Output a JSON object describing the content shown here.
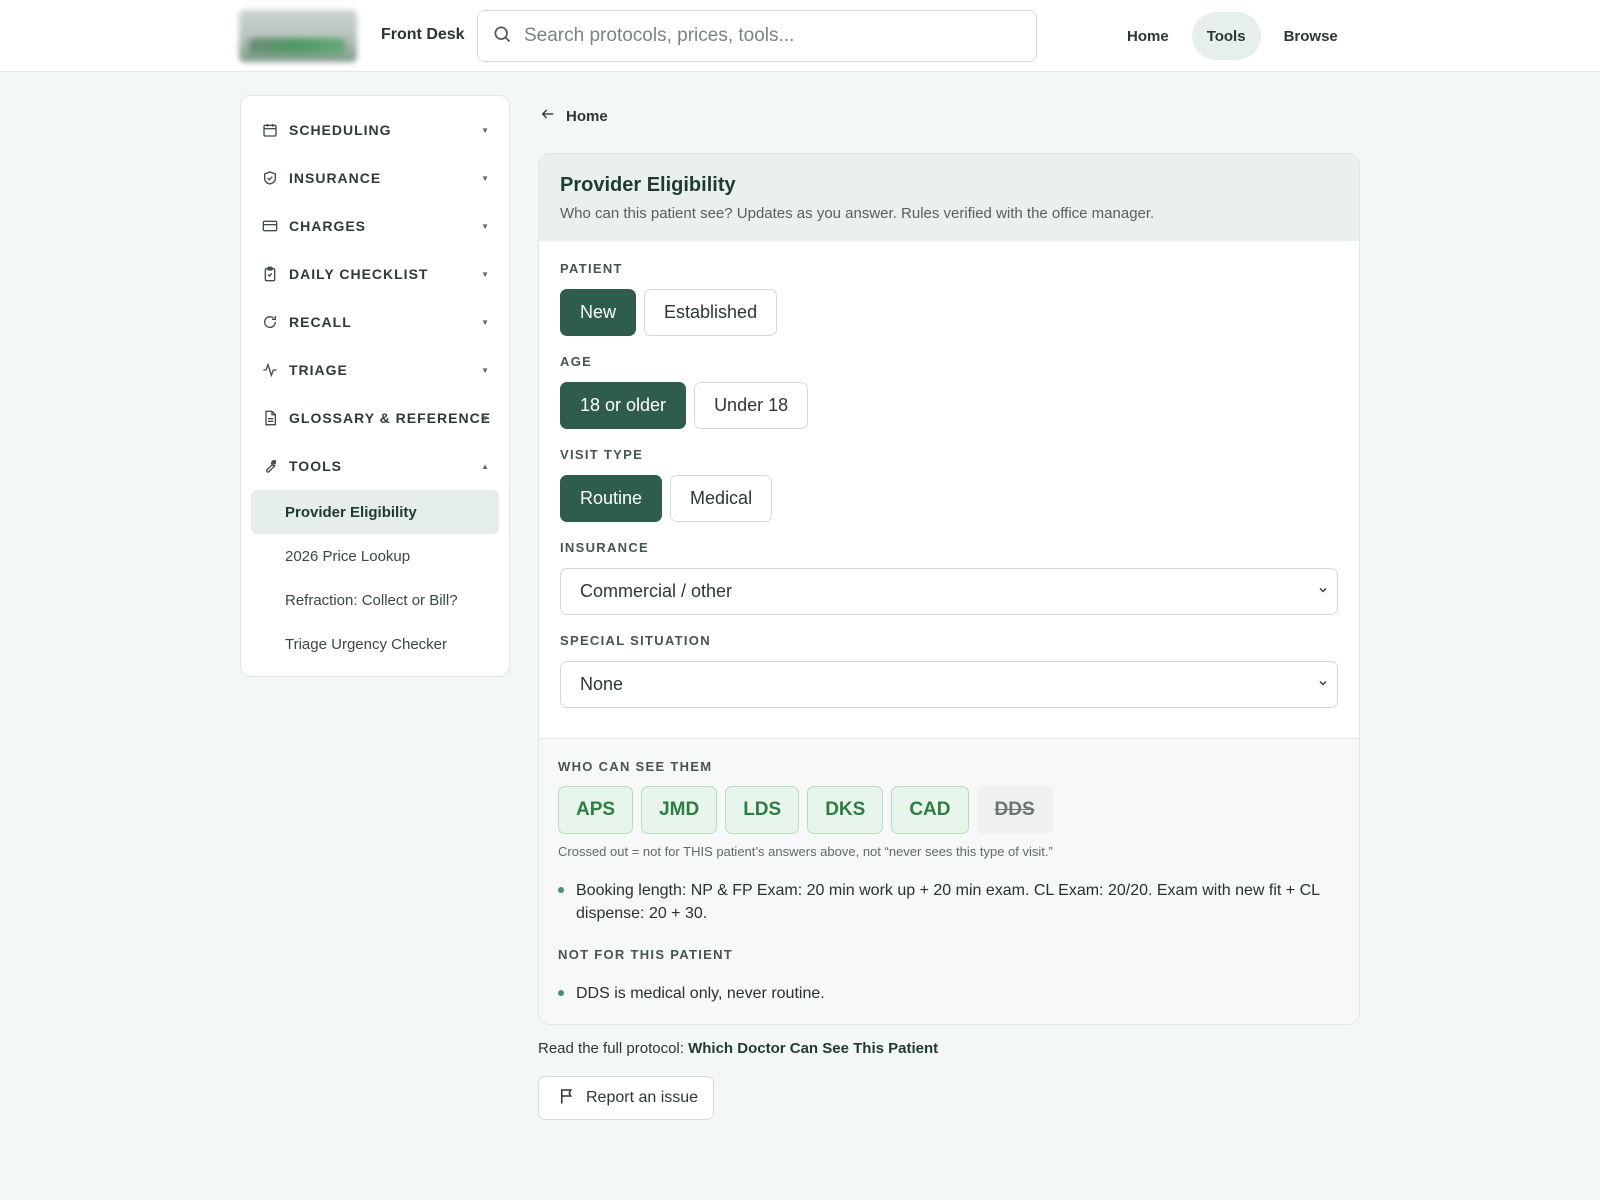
{
  "header": {
    "brand": "Front Desk",
    "search_placeholder": "Search protocols, prices, tools...",
    "nav": [
      {
        "label": "Home",
        "active": false
      },
      {
        "label": "Tools",
        "active": true
      },
      {
        "label": "Browse",
        "active": false
      }
    ]
  },
  "sidebar": {
    "sections": [
      {
        "label": "SCHEDULING",
        "icon": "calendar-icon"
      },
      {
        "label": "INSURANCE",
        "icon": "shield-check-icon"
      },
      {
        "label": "CHARGES",
        "icon": "credit-card-icon"
      },
      {
        "label": "DAILY CHECKLIST",
        "icon": "clipboard-check-icon"
      },
      {
        "label": "RECALL",
        "icon": "refresh-icon"
      },
      {
        "label": "TRIAGE",
        "icon": "activity-icon"
      },
      {
        "label": "GLOSSARY & REFERENCE",
        "icon": "document-icon"
      },
      {
        "label": "TOOLS",
        "icon": "wrench-icon"
      }
    ],
    "tools_items": [
      {
        "label": "Provider Eligibility",
        "active": true
      },
      {
        "label": "2026 Price Lookup",
        "active": false
      },
      {
        "label": "Refraction: Collect or Bill?",
        "active": false
      },
      {
        "label": "Triage Urgency Checker",
        "active": false
      }
    ]
  },
  "main": {
    "back_label": "Home",
    "card": {
      "title": "Provider Eligibility",
      "subtitle": "Who can this patient see? Updates as you answer. Rules verified with the office manager.",
      "patient": {
        "label": "PATIENT",
        "options": [
          "New",
          "Established"
        ],
        "selected": "New"
      },
      "age": {
        "label": "AGE",
        "options": [
          "18 or older",
          "Under 18"
        ],
        "selected": "18 or older"
      },
      "visit_type": {
        "label": "VISIT TYPE",
        "options": [
          "Routine",
          "Medical"
        ],
        "selected": "Routine"
      },
      "insurance": {
        "label": "INSURANCE",
        "value": "Commercial / other"
      },
      "special": {
        "label": "SPECIAL SITUATION",
        "value": "None"
      }
    },
    "result": {
      "label": "WHO CAN SEE THEM",
      "providers": [
        {
          "code": "APS",
          "eligible": true
        },
        {
          "code": "JMD",
          "eligible": true
        },
        {
          "code": "LDS",
          "eligible": true
        },
        {
          "code": "DKS",
          "eligible": true
        },
        {
          "code": "CAD",
          "eligible": true
        },
        {
          "code": "DDS",
          "eligible": false
        }
      ],
      "note": "Crossed out = not for THIS patient’s answers above, not “never sees this type of visit.”",
      "booking": "Booking length: NP & FP Exam: 20 min work up + 20 min exam. CL Exam: 20/20. Exam with new fit + CL dispense: 20 + 30.",
      "not_label": "NOT FOR THIS PATIENT",
      "not_items": [
        "DDS is medical only, never routine."
      ]
    },
    "protocol_prefix": "Read the full protocol:",
    "protocol_link": "Which Doctor Can See This Patient",
    "report_label": "Report an issue"
  }
}
